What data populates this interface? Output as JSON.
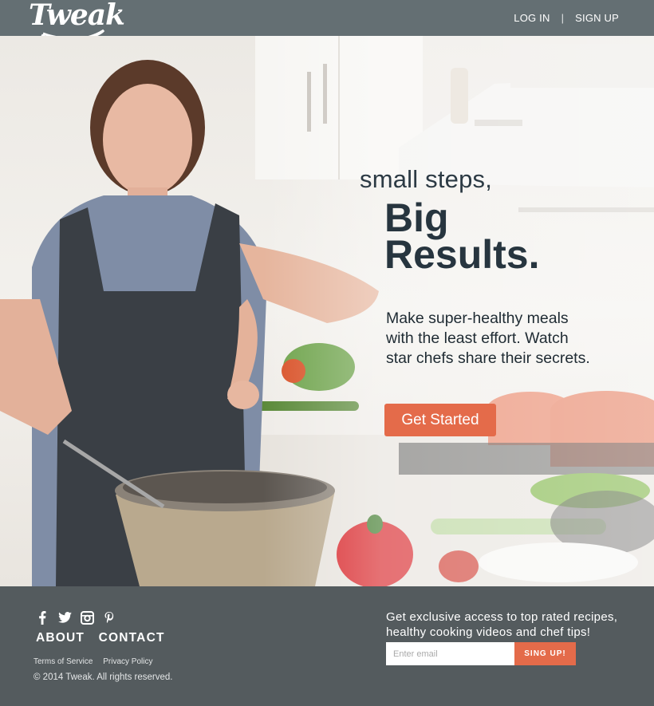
{
  "header": {
    "logo_text": "Tweak",
    "nav": {
      "login": "LOG IN",
      "separator": "|",
      "signup": "SIGN UP"
    }
  },
  "hero": {
    "tagline": "small steps,",
    "headline_line1": "Big",
    "headline_line2": "Results.",
    "description": "Make super-healthy meals with the least effort. Watch star chefs share their secrets.",
    "cta_label": "Get Started"
  },
  "footer": {
    "social_icons": [
      "facebook-icon",
      "twitter-icon",
      "instagram-icon",
      "pinterest-icon"
    ],
    "links": {
      "about": "ABOUT",
      "contact": "CONTACT"
    },
    "legal": {
      "terms": "Terms of Service",
      "privacy": "Privacy Policy"
    },
    "copyright": "© 2014 Tweak. All rights reserved.",
    "promo": "Get exclusive access to top rated recipes, healthy cooking videos and chef tips!",
    "email_placeholder": "Enter email",
    "signup_button": "SING UP!"
  },
  "colors": {
    "header_bg": "#646f73",
    "footer_bg": "#545b5e",
    "accent": "#e46b4a",
    "headline": "#27353f"
  }
}
